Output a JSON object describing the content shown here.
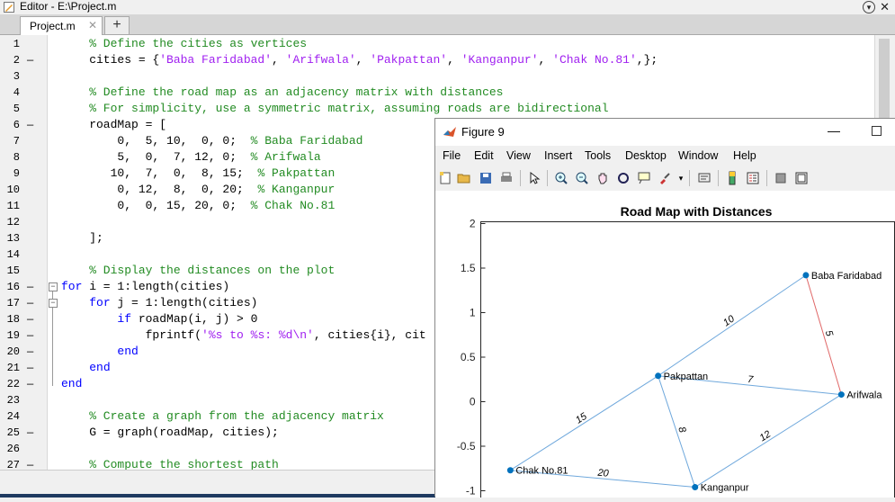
{
  "window": {
    "title": "Editor - E:\\Project.m"
  },
  "tabs": {
    "active_label": "Project.m",
    "close_glyph": "✕",
    "add_glyph": "+"
  },
  "code_lines": [
    {
      "n": "1",
      "dash": "",
      "parts": [
        [
          "cmt",
          "    % Define the cities as vertices"
        ]
      ]
    },
    {
      "n": "2",
      "dash": "—",
      "parts": [
        [
          "",
          "    cities = {"
        ],
        [
          "str",
          "'Baba Faridabad'"
        ],
        [
          "",
          ", "
        ],
        [
          "str",
          "'Arifwala'"
        ],
        [
          "",
          ", "
        ],
        [
          "str",
          "'Pakpattan'"
        ],
        [
          "",
          ", "
        ],
        [
          "str",
          "'Kanganpur'"
        ],
        [
          "",
          ", "
        ],
        [
          "str",
          "'Chak No.81'"
        ],
        [
          "",
          ",};"
        ]
      ]
    },
    {
      "n": "3",
      "dash": "",
      "parts": []
    },
    {
      "n": "4",
      "dash": "",
      "parts": [
        [
          "cmt",
          "    % Define the road map as an adjacency matrix with distances"
        ]
      ]
    },
    {
      "n": "5",
      "dash": "",
      "parts": [
        [
          "cmt",
          "    % For simplicity, use a symmetric matrix, assuming roads are bidirectional"
        ]
      ]
    },
    {
      "n": "6",
      "dash": "—",
      "parts": [
        [
          "",
          "    roadMap = ["
        ]
      ]
    },
    {
      "n": "7",
      "dash": "",
      "parts": [
        [
          "",
          "        0,  5, 10,  0, 0;  "
        ],
        [
          "cmt",
          "% Baba Faridabad"
        ]
      ]
    },
    {
      "n": "8",
      "dash": "",
      "parts": [
        [
          "",
          "        5,  0,  7, 12, 0;  "
        ],
        [
          "cmt",
          "% Arifwala"
        ]
      ]
    },
    {
      "n": "9",
      "dash": "",
      "parts": [
        [
          "",
          "       10,  7,  0,  8, 15;  "
        ],
        [
          "cmt",
          "% Pakpattan"
        ]
      ]
    },
    {
      "n": "10",
      "dash": "",
      "parts": [
        [
          "",
          "        0, 12,  8,  0, 20;  "
        ],
        [
          "cmt",
          "% Kanganpur"
        ]
      ]
    },
    {
      "n": "11",
      "dash": "",
      "parts": [
        [
          "",
          "        0,  0, 15, 20, 0;  "
        ],
        [
          "cmt",
          "% Chak No.81"
        ]
      ]
    },
    {
      "n": "12",
      "dash": "",
      "parts": []
    },
    {
      "n": "13",
      "dash": "",
      "parts": [
        [
          "",
          "    ];"
        ]
      ]
    },
    {
      "n": "14",
      "dash": "",
      "parts": []
    },
    {
      "n": "15",
      "dash": "",
      "parts": [
        [
          "cmt",
          "    % Display the distances on the plot"
        ]
      ]
    },
    {
      "n": "16",
      "dash": "—",
      "fold": "−",
      "parts": [
        [
          "kw",
          "for"
        ],
        [
          "",
          " i = 1:length(cities)"
        ]
      ]
    },
    {
      "n": "17",
      "dash": "—",
      "fold": "−",
      "parts": [
        [
          "",
          "    "
        ],
        [
          "kw",
          "for"
        ],
        [
          "",
          " j = 1:length(cities)"
        ]
      ]
    },
    {
      "n": "18",
      "dash": "—",
      "parts": [
        [
          "",
          "        "
        ],
        [
          "kw",
          "if"
        ],
        [
          "",
          " roadMap(i, j) > 0"
        ]
      ]
    },
    {
      "n": "19",
      "dash": "—",
      "parts": [
        [
          "",
          "            fprintf("
        ],
        [
          "str",
          "'%s to %s: %d\\n'"
        ],
        [
          "",
          ", cities{i}, cit"
        ]
      ]
    },
    {
      "n": "20",
      "dash": "—",
      "parts": [
        [
          "",
          "        "
        ],
        [
          "kw",
          "end"
        ]
      ]
    },
    {
      "n": "21",
      "dash": "—",
      "parts": [
        [
          "",
          "    "
        ],
        [
          "kw",
          "end"
        ]
      ]
    },
    {
      "n": "22",
      "dash": "—",
      "parts": [
        [
          "kw",
          "end"
        ]
      ]
    },
    {
      "n": "23",
      "dash": "",
      "parts": []
    },
    {
      "n": "24",
      "dash": "",
      "parts": [
        [
          "cmt",
          "    % Create a graph from the adjacency matrix"
        ]
      ]
    },
    {
      "n": "25",
      "dash": "—",
      "parts": [
        [
          "",
          "    G = graph(roadMap, cities);"
        ]
      ]
    },
    {
      "n": "26",
      "dash": "",
      "parts": []
    },
    {
      "n": "27",
      "dash": "—",
      "parts": [
        [
          "cmt",
          "    % Compute the shortest path"
        ]
      ]
    }
  ],
  "figure": {
    "window_title": "Figure 9",
    "menu": [
      "File",
      "Edit",
      "View",
      "Insert",
      "Tools",
      "Desktop",
      "Window",
      "Help"
    ],
    "toolbar_icons": [
      "new-figure-icon",
      "open-icon",
      "save-icon",
      "print-icon",
      "pointer-icon",
      "zoom-in-icon",
      "zoom-out-icon",
      "pan-icon",
      "rotate-icon",
      "data-cursor-icon",
      "brush-icon",
      "link-icon",
      "colorbar-icon",
      "legend-icon",
      "hide-tools-icon",
      "dock-icon"
    ],
    "colors": {
      "edge": "#6fa8dc",
      "highlight": "#e06666",
      "node": "#0072bd"
    }
  },
  "chart_data": {
    "type": "graph",
    "title": "Road Map with Distances",
    "ylim": [
      -1,
      2
    ],
    "yticks": [
      "2",
      "1.5",
      "1",
      "0.5",
      "0",
      "-0.5",
      "-1"
    ],
    "nodes": [
      {
        "label": "Baba Faridabad",
        "x": 1.0,
        "y": 1.42
      },
      {
        "label": "Arifwala",
        "x": 1.24,
        "y": 0.08
      },
      {
        "label": "Pakpattan",
        "x": 0.0,
        "y": 0.29
      },
      {
        "label": "Kanganpur",
        "x": 0.25,
        "y": -0.96
      },
      {
        "label": "Chak No.81",
        "x": -1.0,
        "y": -0.77
      }
    ],
    "edges": [
      {
        "from": 0,
        "to": 1,
        "weight": "5",
        "highlight": true
      },
      {
        "from": 0,
        "to": 2,
        "weight": "10"
      },
      {
        "from": 1,
        "to": 2,
        "weight": "7"
      },
      {
        "from": 1,
        "to": 3,
        "weight": "12"
      },
      {
        "from": 2,
        "to": 3,
        "weight": "8"
      },
      {
        "from": 2,
        "to": 4,
        "weight": "15"
      },
      {
        "from": 3,
        "to": 4,
        "weight": "20"
      }
    ]
  }
}
